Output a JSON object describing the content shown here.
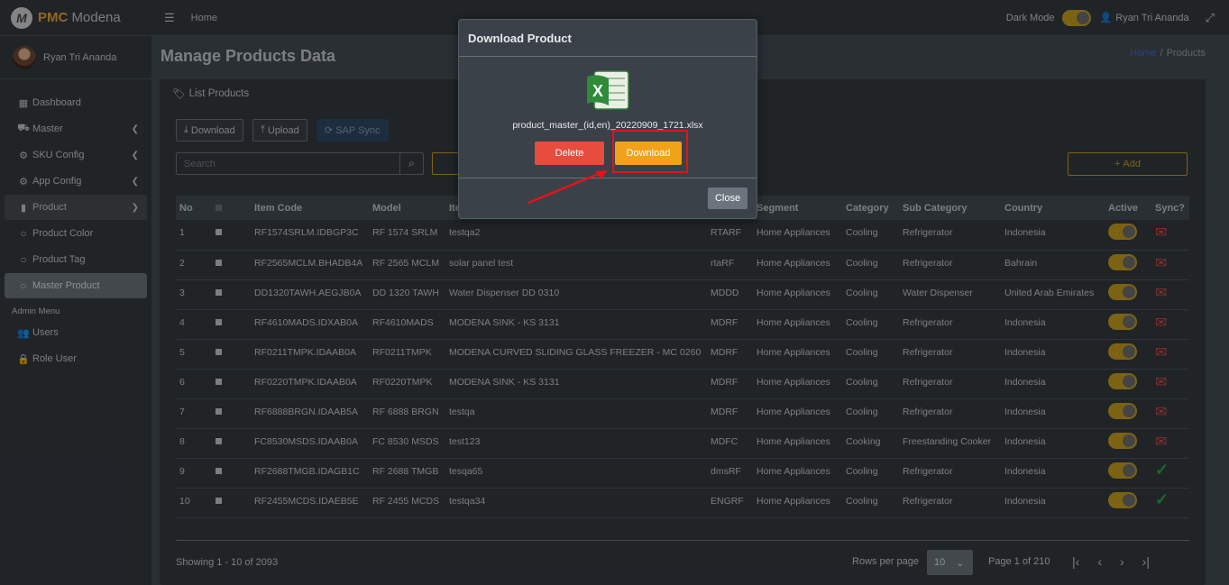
{
  "brand": {
    "logo_letter": "M",
    "name_bold": "PMC",
    "name_rest": " Modena"
  },
  "sidebar": {
    "user": "Ryan Tri Ananda",
    "items": [
      {
        "label": "Dashboard",
        "icon": "th-icon"
      },
      {
        "label": "Master",
        "icon": "car-icon"
      },
      {
        "label": "SKU Config",
        "icon": "gear-icon"
      },
      {
        "label": "App Config",
        "icon": "gear-icon"
      },
      {
        "label": "Product",
        "icon": "file-icon"
      },
      {
        "label": "Product Color",
        "icon": "circle-icon"
      },
      {
        "label": "Product Tag",
        "icon": "circle-icon"
      },
      {
        "label": "Master Product",
        "icon": "circle-icon"
      }
    ],
    "admin_header": "Admin Menu",
    "admin_items": [
      {
        "label": "Users",
        "icon": "users-icon"
      },
      {
        "label": "Role User",
        "icon": "lock-icon"
      }
    ]
  },
  "topbar": {
    "home": "Home",
    "dark_mode": "Dark Mode",
    "user": "Ryan Tri Ananda"
  },
  "page": {
    "title": "Manage Products Data",
    "breadcrumb_home": "Home",
    "breadcrumb_sep": "/",
    "breadcrumb_current": "Products"
  },
  "card": {
    "title": "List Products",
    "btn_download": "Download",
    "btn_upload": "Upload",
    "btn_sap": "SAP Sync",
    "search_placeholder": "Search",
    "btn_add": "Add"
  },
  "table": {
    "headers": [
      "No",
      "",
      "Item Code",
      "Model",
      "Ite",
      "Segment",
      "Category",
      "Sub Category",
      "Country",
      "Active",
      "Sync?"
    ],
    "rows": [
      {
        "no": "1",
        "code": "RF1574SRLM.IDBGP3C",
        "model": "RF 1574 SRLM",
        "name": "testqa2",
        "brand": "RTARF",
        "segment": "Home Appliances",
        "category": "Cooling",
        "sub": "Refrigerator",
        "country": "Indonesia",
        "sync": "x"
      },
      {
        "no": "2",
        "code": "RF2565MCLM.BHADB4A",
        "model": "RF 2565 MCLM",
        "name": "solar panel test",
        "brand": "rtaRF",
        "segment": "Home Appliances",
        "category": "Cooling",
        "sub": "Refrigerator",
        "country": "Bahrain",
        "sync": "x"
      },
      {
        "no": "3",
        "code": "DD1320TAWH.AEGJB0A",
        "model": "DD 1320 TAWH",
        "name": "Water Dispenser DD 0310",
        "brand": "MDDD",
        "segment": "Home Appliances",
        "category": "Cooling",
        "sub": "Water Dispenser",
        "country": "United Arab Emirates",
        "sync": "x"
      },
      {
        "no": "4",
        "code": "RF4610MADS.IDXAB0A",
        "model": "RF4610MADS",
        "name": "MODENA SINK - KS 3131",
        "brand": "MDRF",
        "segment": "Home Appliances",
        "category": "Cooling",
        "sub": "Refrigerator",
        "country": "Indonesia",
        "sync": "x"
      },
      {
        "no": "5",
        "code": "RF0211TMPK.IDAAB0A",
        "model": "RF0211TMPK",
        "name": "MODENA CURVED SLIDING GLASS FREEZER - MC 0260",
        "brand": "MDRF",
        "segment": "Home Appliances",
        "category": "Cooling",
        "sub": "Refrigerator",
        "country": "Indonesia",
        "sync": "x"
      },
      {
        "no": "6",
        "code": "RF0220TMPK.IDAAB0A",
        "model": "RF0220TMPK",
        "name": "MODENA SINK - KS 3131",
        "brand": "MDRF",
        "segment": "Home Appliances",
        "category": "Cooling",
        "sub": "Refrigerator",
        "country": "Indonesia",
        "sync": "x"
      },
      {
        "no": "7",
        "code": "RF6888BRGN.IDAAB5A",
        "model": "RF 6888 BRGN",
        "name": "testqa",
        "brand": "MDRF",
        "segment": "Home Appliances",
        "category": "Cooling",
        "sub": "Refrigerator",
        "country": "Indonesia",
        "sync": "x"
      },
      {
        "no": "8",
        "code": "FC8530MSDS.IDAAB0A",
        "model": "FC 8530 MSDS",
        "name": "test123",
        "brand": "MDFC",
        "segment": "Home Appliances",
        "category": "Cooking",
        "sub": "Freestanding Cooker",
        "country": "Indonesia",
        "sync": "x"
      },
      {
        "no": "9",
        "code": "RF2688TMGB.IDAGB1C",
        "model": "RF 2688 TMGB",
        "name": "tesqa65",
        "brand": "dmsRF",
        "segment": "Home Appliances",
        "category": "Cooling",
        "sub": "Refrigerator",
        "country": "Indonesia",
        "sync": "ok"
      },
      {
        "no": "10",
        "code": "RF2455MCDS.IDAEB5E",
        "model": "RF 2455 MCDS",
        "name": "testqa34",
        "brand": "ENGRF",
        "segment": "Home Appliances",
        "category": "Cooling",
        "sub": "Refrigerator",
        "country": "Indonesia",
        "sync": "ok"
      }
    ]
  },
  "footer": {
    "showing": "Showing 1 - 10 of 2093",
    "rows_per_page": "Rows per page",
    "rows_value": "10",
    "page_of": "Page 1 of 210"
  },
  "modal": {
    "title": "Download Product",
    "file_name": "product_master_(id,en)_20220909_1721.xlsx",
    "btn_delete": "Delete",
    "btn_download": "Download",
    "btn_close": "Close"
  },
  "colors": {
    "accent": "#c9a01f",
    "danger": "#e84c3d",
    "warning": "#f0a21a",
    "highlight": "#e6121a"
  }
}
